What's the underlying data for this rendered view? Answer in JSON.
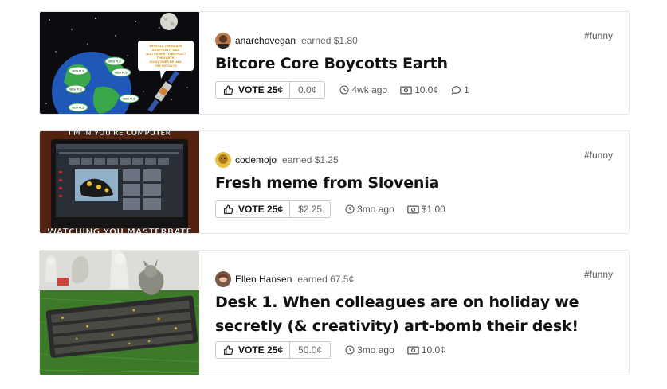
{
  "posts": [
    {
      "tag": "#funny",
      "author": "anarchovegan",
      "earned": "earned $1.80",
      "title": "Bitcore Core Boycotts Earth",
      "vote_label": "VOTE 25¢",
      "vote_amount": "0.0¢",
      "age": "4wk ago",
      "tips": "10.0¢",
      "comments": "1",
      "thumb_bubble": "WITH ALL THE BCASH ADOPTION IT WAS JUST EASIER TO BOYCOTT THE EARTH. GOOD TIMES BE HAD. THE BITCOLTS",
      "thumb_badge": "BCH PLS"
    },
    {
      "tag": "#funny",
      "author": "codemojo",
      "earned": "earned $1.25",
      "title": "Fresh meme from Slovenia",
      "vote_label": "VOTE 25¢",
      "vote_amount": "$2.25",
      "age": "3mo ago",
      "tips": "$1.00",
      "thumb_top": "I'M IN YOU'RE COMPUTER",
      "thumb_bottom": "WATCHING YOU MASTERBATE"
    },
    {
      "tag": "#funny",
      "author": "Ellen Hansen",
      "earned": "earned 67.5¢",
      "title": "Desk 1. When colleagues are on holiday we secretly (& creativity) art-bomb their desk!",
      "vote_label": "VOTE 25¢",
      "vote_amount": "50.0¢",
      "age": "3mo ago",
      "tips": "10.0¢"
    }
  ],
  "icons": {
    "vote": "thumbs-up-icon",
    "age": "clock-icon",
    "tips": "money-icon",
    "comments": "comment-icon"
  },
  "colors": {
    "card_border": "#e6e6e6",
    "title": "#111111",
    "meta": "#555555"
  }
}
